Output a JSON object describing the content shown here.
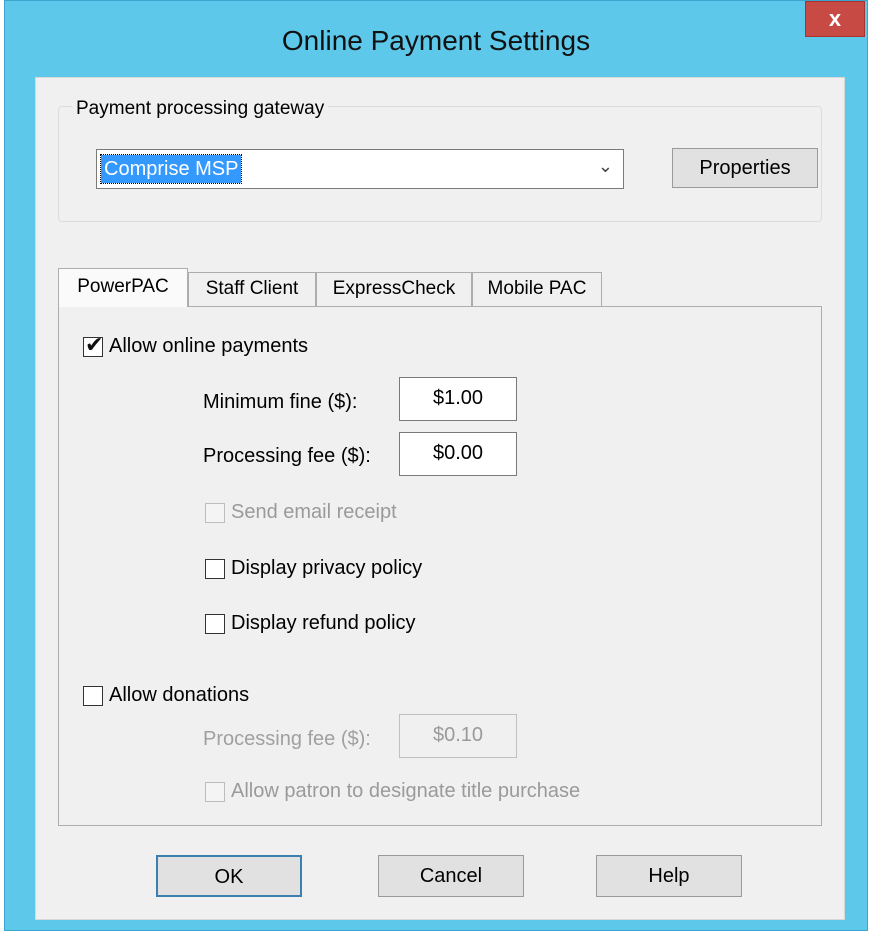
{
  "window": {
    "title": "Online Payment Settings",
    "close_label": "x"
  },
  "gateway": {
    "group_label": "Payment processing gateway",
    "selected": "Comprise MSP",
    "dropdown_arrow": "⌄",
    "properties_label": "Properties"
  },
  "tabs": [
    {
      "label": "PowerPAC",
      "active": true
    },
    {
      "label": "Staff Client",
      "active": false
    },
    {
      "label": "ExpressCheck",
      "active": false
    },
    {
      "label": "Mobile PAC",
      "active": false
    }
  ],
  "powerpac": {
    "allow_online_payments": {
      "label": "Allow online payments",
      "checked": true
    },
    "minimum_fine": {
      "label": "Minimum fine ($):",
      "value": "$1.00"
    },
    "processing_fee": {
      "label": "Processing fee ($):",
      "value": "$0.00"
    },
    "send_email_receipt": {
      "label": "Send email receipt",
      "checked": false,
      "disabled": true
    },
    "display_privacy_policy": {
      "label": "Display privacy policy",
      "checked": false
    },
    "display_refund_policy": {
      "label": "Display refund policy",
      "checked": false
    },
    "allow_donations": {
      "label": "Allow donations",
      "checked": false
    },
    "donation_processing_fee": {
      "label": "Processing fee ($):",
      "value": "$0.10",
      "disabled": true
    },
    "designate_title": {
      "label": "Allow patron to designate title purchase",
      "checked": false,
      "disabled": true
    }
  },
  "buttons": {
    "ok": "OK",
    "cancel": "Cancel",
    "help": "Help"
  },
  "icons": {
    "check": "✔"
  }
}
